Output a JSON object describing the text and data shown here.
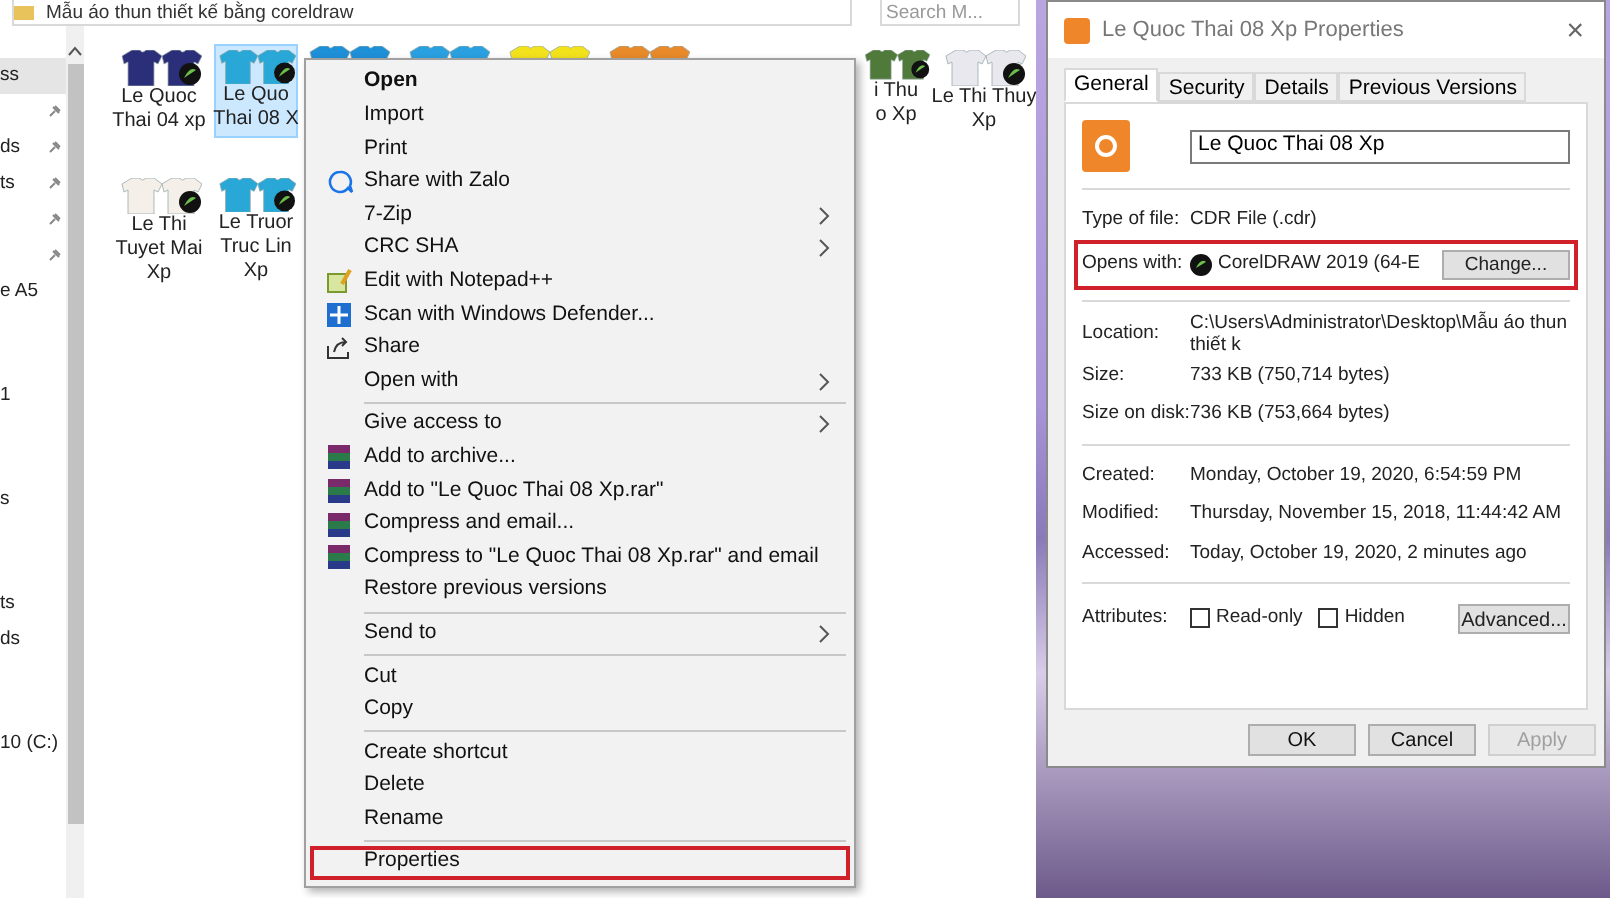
{
  "explorer": {
    "address": "Mẫu áo thun thiết kế bằng coreldraw",
    "search_placeholder": "Search M...",
    "nav": [
      [
        {
          "label": "ss",
          "pinned": false,
          "selected": true
        },
        {
          "pinned": true,
          "selected": false
        },
        {
          "label": "ds",
          "pinned": true,
          "selected": false
        },
        {
          "label": "ts",
          "pinned": true,
          "selected": false
        },
        {
          "pinned": true,
          "selected": false
        },
        {
          "pinned": true,
          "selected": false
        },
        {
          "label": "e A5",
          "pinned": false,
          "selected": false
        }
      ],
      [
        {
          "label": "1",
          "pinned": false,
          "selected": false
        }
      ],
      [
        {
          "label": "s",
          "pinned": false,
          "selected": false
        }
      ],
      [
        {
          "label": "ts",
          "pinned": false,
          "selected": false
        },
        {
          "label": "ds",
          "pinned": false,
          "selected": false
        }
      ],
      [
        {
          "label": "10 (C:)",
          "pinned": false,
          "selected": false
        }
      ]
    ],
    "files": [
      {
        "lines": [
          "Le Quoc",
          "Thai 04 xp"
        ],
        "color": "#2b2f7a",
        "selected": false
      },
      {
        "lines": [
          "Le Quo",
          "Thai 08 X"
        ],
        "color": "#29a8d8",
        "selected": true
      },
      {
        "color": "#1e90d8",
        "selected": false
      },
      {
        "color": "#2aa0e0",
        "selected": false
      },
      {
        "color": "#f2e21c",
        "selected": false
      },
      {
        "color": "#e88a2a",
        "selected": false
      },
      {
        "lines": [
          "i Thu",
          "o Xp"
        ],
        "color": "#4f7a3a",
        "selected": false
      },
      {
        "lines": [
          "Le Thi Thuy",
          "Xp"
        ],
        "color": "#e8e8ee",
        "selected": false
      },
      {
        "lines": [
          "Le Thi",
          "Tuyet Mai",
          "Xp"
        ],
        "color": "#f4efe8",
        "selected": false
      },
      {
        "lines": [
          "Le Truor",
          "Truc Lin",
          "Xp"
        ],
        "color": "#29a8d8",
        "selected": false
      }
    ]
  },
  "context_menu": [
    {
      "kind": "item",
      "label": "Open",
      "default": true,
      "submenu": false,
      "outlined": false
    },
    {
      "kind": "item",
      "label": "Import",
      "default": false,
      "submenu": false,
      "outlined": false
    },
    {
      "kind": "item",
      "label": "Print",
      "default": false,
      "submenu": false,
      "outlined": false
    },
    {
      "kind": "item",
      "label": "Share with Zalo",
      "default": false,
      "submenu": false,
      "outlined": false
    },
    {
      "kind": "item",
      "label": "7-Zip",
      "default": false,
      "submenu": true,
      "outlined": false
    },
    {
      "kind": "item",
      "label": "CRC SHA",
      "default": false,
      "submenu": true,
      "outlined": false
    },
    {
      "kind": "item",
      "label": "Edit with Notepad++",
      "default": false,
      "submenu": false,
      "outlined": false
    },
    {
      "kind": "item",
      "label": "Scan with Windows Defender...",
      "default": false,
      "submenu": false,
      "outlined": false
    },
    {
      "kind": "item",
      "label": "Share",
      "default": false,
      "submenu": false,
      "outlined": false
    },
    {
      "kind": "item",
      "label": "Open with",
      "default": false,
      "submenu": true,
      "outlined": false
    },
    {
      "kind": "separator"
    },
    {
      "kind": "item",
      "label": "Give access to",
      "default": false,
      "submenu": true,
      "outlined": false
    },
    {
      "kind": "item",
      "label": "Add to archive...",
      "default": false,
      "submenu": false,
      "outlined": false
    },
    {
      "kind": "item",
      "label": "Add to \"Le Quoc Thai 08 Xp.rar\"",
      "default": false,
      "submenu": false,
      "outlined": false
    },
    {
      "kind": "item",
      "label": "Compress and email...",
      "default": false,
      "submenu": false,
      "outlined": false
    },
    {
      "kind": "item",
      "label": "Compress to \"Le Quoc Thai 08 Xp.rar\" and email",
      "default": false,
      "submenu": false,
      "outlined": false
    },
    {
      "kind": "item",
      "label": "Restore previous versions",
      "default": false,
      "submenu": false,
      "outlined": false
    },
    {
      "kind": "separator"
    },
    {
      "kind": "item",
      "label": "Send to",
      "default": false,
      "submenu": true,
      "outlined": false
    },
    {
      "kind": "separator"
    },
    {
      "kind": "item",
      "label": "Cut",
      "default": false,
      "submenu": false,
      "outlined": false
    },
    {
      "kind": "item",
      "label": "Copy",
      "default": false,
      "submenu": false,
      "outlined": false
    },
    {
      "kind": "separator"
    },
    {
      "kind": "item",
      "label": "Create shortcut",
      "default": false,
      "submenu": false,
      "outlined": false
    },
    {
      "kind": "item",
      "label": "Delete",
      "default": false,
      "submenu": false,
      "outlined": false
    },
    {
      "kind": "item",
      "label": "Rename",
      "default": false,
      "submenu": false,
      "outlined": false
    },
    {
      "kind": "separator"
    },
    {
      "kind": "item",
      "label": "Properties",
      "default": false,
      "submenu": false,
      "outlined": true
    }
  ],
  "properties_dialog": {
    "title": "Le Quoc Thai 08 Xp Properties",
    "close": "×",
    "tabs": [
      {
        "label": "General",
        "selected": true
      },
      {
        "label": "Security",
        "selected": false
      },
      {
        "label": "Details",
        "selected": false
      },
      {
        "label": "Previous Versions",
        "selected": false
      }
    ],
    "file_name": "Le Quoc Thai 08 Xp",
    "sections": [
      [
        {
          "kind": "text",
          "label": "Type of file:",
          "value": "CDR File (.cdr)"
        },
        {
          "kind": "opens_with",
          "label": "Opens with:",
          "value": "CorelDRAW 2019 (64-E",
          "button": "Change...",
          "outlined": true
        }
      ],
      [
        {
          "kind": "text",
          "label": "Location:",
          "value": "C:\\Users\\Administrator\\Desktop\\Mẫu áo thun thiết k"
        },
        {
          "kind": "text",
          "label": "Size:",
          "value": "733 KB (750,714 bytes)"
        },
        {
          "kind": "text",
          "label": "Size on disk:",
          "value": "736 KB (753,664 bytes)"
        }
      ],
      [
        {
          "kind": "text",
          "label": "Created:",
          "value": "Monday, October 19, 2020, 6:54:59 PM"
        },
        {
          "kind": "text",
          "label": "Modified:",
          "value": "Thursday, November 15, 2018, 11:44:42 AM"
        },
        {
          "kind": "text",
          "label": "Accessed:",
          "value": "Today, October 19, 2020, 2 minutes ago"
        }
      ],
      [
        {
          "kind": "attributes",
          "label": "Attributes:",
          "checkboxes": [
            {
              "label": "Read-only",
              "checked": false
            },
            {
              "label": "Hidden",
              "checked": false
            }
          ],
          "button": "Advanced..."
        }
      ]
    ],
    "buttons": [
      {
        "label": "OK",
        "disabled": false
      },
      {
        "label": "Cancel",
        "disabled": false
      },
      {
        "label": "Apply",
        "disabled": true
      }
    ]
  }
}
